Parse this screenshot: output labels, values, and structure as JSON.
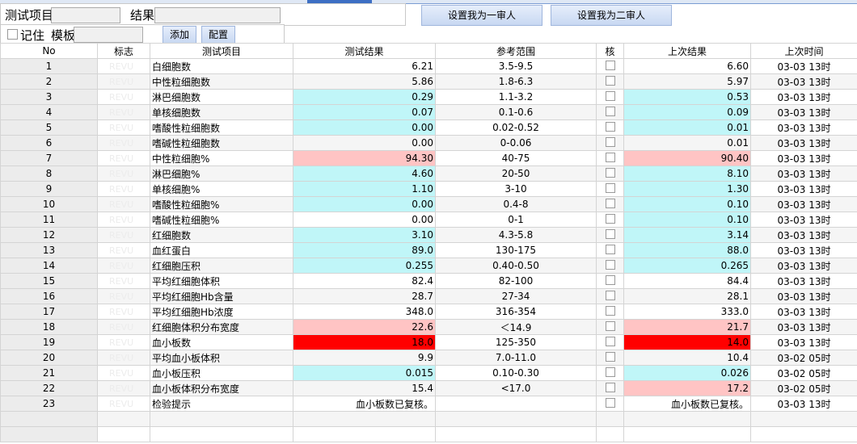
{
  "filters": {
    "test_item_label": "测试项目",
    "result_label": "结果",
    "remember_label": "记住",
    "template_label": "模板",
    "add_button": "添加",
    "config_button": "配置"
  },
  "actions": {
    "first_reviewer": "设置我为一审人",
    "second_reviewer": "设置我为二审人"
  },
  "columns": [
    "No",
    "标志",
    "测试项目",
    "测试结果",
    "参考范围",
    "核",
    "上次结果",
    "上次时间"
  ],
  "flag_text": "REVU",
  "colors": {
    "cyan": "#c0f6f8",
    "pink": "#ffc4c4",
    "red": "#ff0000"
  },
  "rows": [
    {
      "no": "1",
      "item": "白细胞数",
      "result": "6.21",
      "range": "3.5-9.5",
      "last": "6.60",
      "time": "03-03 13时",
      "rc": "",
      "lc": ""
    },
    {
      "no": "2",
      "item": "中性粒细胞数",
      "result": "5.86",
      "range": "1.8-6.3",
      "last": "5.97",
      "time": "03-03 13时",
      "rc": "",
      "lc": ""
    },
    {
      "no": "3",
      "item": "淋巴细胞数",
      "result": "0.29",
      "range": "1.1-3.2",
      "last": "0.53",
      "time": "03-03 13时",
      "rc": "cy",
      "lc": "cy"
    },
    {
      "no": "4",
      "item": "单核细胞数",
      "result": "0.07",
      "range": "0.1-0.6",
      "last": "0.09",
      "time": "03-03 13时",
      "rc": "cy",
      "lc": "cy"
    },
    {
      "no": "5",
      "item": "嗜酸性粒细胞数",
      "result": "0.00",
      "range": "0.02-0.52",
      "last": "0.01",
      "time": "03-03 13时",
      "rc": "cy",
      "lc": "cy"
    },
    {
      "no": "6",
      "item": "嗜碱性粒细胞数",
      "result": "0.00",
      "range": "0-0.06",
      "last": "0.01",
      "time": "03-03 13时",
      "rc": "",
      "lc": ""
    },
    {
      "no": "7",
      "item": "中性粒细胞%",
      "result": "94.30",
      "range": "40-75",
      "last": "90.40",
      "time": "03-03 13时",
      "rc": "pk",
      "lc": "pk"
    },
    {
      "no": "8",
      "item": "淋巴细胞%",
      "result": "4.60",
      "range": "20-50",
      "last": "8.10",
      "time": "03-03 13时",
      "rc": "cy",
      "lc": "cy"
    },
    {
      "no": "9",
      "item": "单核细胞%",
      "result": "1.10",
      "range": "3-10",
      "last": "1.30",
      "time": "03-03 13时",
      "rc": "cy",
      "lc": "cy"
    },
    {
      "no": "10",
      "item": "嗜酸性粒细胞%",
      "result": "0.00",
      "range": "0.4-8",
      "last": "0.10",
      "time": "03-03 13时",
      "rc": "cy",
      "lc": "cy"
    },
    {
      "no": "11",
      "item": "嗜碱性粒细胞%",
      "result": "0.00",
      "range": "0-1",
      "last": "0.10",
      "time": "03-03 13时",
      "rc": "",
      "lc": "cy"
    },
    {
      "no": "12",
      "item": "红细胞数",
      "result": "3.10",
      "range": "4.3-5.8",
      "last": "3.14",
      "time": "03-03 13时",
      "rc": "cy",
      "lc": "cy"
    },
    {
      "no": "13",
      "item": "血红蛋白",
      "result": "89.0",
      "range": "130-175",
      "last": "88.0",
      "time": "03-03 13时",
      "rc": "cy",
      "lc": "cy"
    },
    {
      "no": "14",
      "item": "红细胞压积",
      "result": "0.255",
      "range": "0.40-0.50",
      "last": "0.265",
      "time": "03-03 13时",
      "rc": "cy",
      "lc": "cy"
    },
    {
      "no": "15",
      "item": "平均红细胞体积",
      "result": "82.4",
      "range": "82-100",
      "last": "84.4",
      "time": "03-03 13时",
      "rc": "",
      "lc": ""
    },
    {
      "no": "16",
      "item": "平均红细胞Hb含量",
      "result": "28.7",
      "range": "27-34",
      "last": "28.1",
      "time": "03-03 13时",
      "rc": "",
      "lc": ""
    },
    {
      "no": "17",
      "item": "平均红细胞Hb浓度",
      "result": "348.0",
      "range": "316-354",
      "last": "333.0",
      "time": "03-03 13时",
      "rc": "",
      "lc": ""
    },
    {
      "no": "18",
      "item": "红细胞体积分布宽度",
      "result": "22.6",
      "range": "＜14.9",
      "last": "21.7",
      "time": "03-03 13时",
      "rc": "pk",
      "lc": "pk"
    },
    {
      "no": "19",
      "item": "血小板数",
      "result": "18.0",
      "range": "125-350",
      "last": "14.0",
      "time": "03-03 13时",
      "rc": "rd",
      "lc": "rd"
    },
    {
      "no": "20",
      "item": "平均血小板体积",
      "result": "9.9",
      "range": "7.0-11.0",
      "last": "10.4",
      "time": "03-02 05时",
      "rc": "",
      "lc": ""
    },
    {
      "no": "21",
      "item": "血小板压积",
      "result": "0.015",
      "range": "0.10-0.30",
      "last": "0.026",
      "time": "03-02 05时",
      "rc": "cy",
      "lc": "cy"
    },
    {
      "no": "22",
      "item": "血小板体积分布宽度",
      "result": "15.4",
      "range": "<17.0",
      "last": "17.2",
      "time": "03-02 05时",
      "rc": "",
      "lc": "pk"
    },
    {
      "no": "23",
      "item": "检验提示",
      "result": "血小板数已复核。",
      "range": "",
      "last": "血小板数已复核。",
      "time": "03-03 13时",
      "rc": "",
      "lc": ""
    }
  ]
}
